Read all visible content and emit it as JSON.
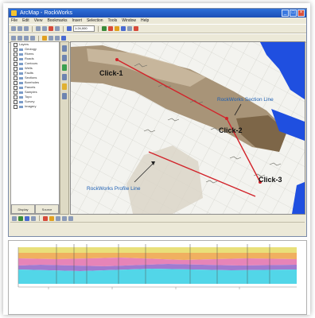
{
  "window": {
    "title": "ArcMap - RockWorks",
    "menu": [
      "File",
      "Edit",
      "View",
      "Bookmarks",
      "Insert",
      "Selection",
      "Tools",
      "Window",
      "Help"
    ],
    "scale_value": "1:24,000"
  },
  "toc": {
    "layers": [
      "Layers",
      "Geology",
      "Rivers",
      "Roads",
      "Contours",
      "Wells",
      "Faults",
      "Sections",
      "Boreholes",
      "Parcels",
      "Samples",
      "Topo",
      "Survey",
      "Imagery"
    ],
    "tabs": [
      "Display",
      "Source"
    ]
  },
  "map": {
    "annotations": {
      "click1": "Click-1",
      "click2": "Click-2",
      "click3": "Click-3",
      "section_line": "RockWorks Section Line",
      "profile_line": "RockWorks Profile Line"
    },
    "colors": {
      "water": "#1f4fe0",
      "terrain_brown": "#a89478",
      "terrain_dark": "#7d6648",
      "terrain_light": "#cdbca2",
      "section_line": "#d2232a"
    }
  },
  "profile": {
    "colors": {
      "top_band": "#e9e07a",
      "orange_band": "#f0b060",
      "pink_band": "#e684b8",
      "purple_band": "#a07ad0",
      "cyan_band": "#52d6e8"
    }
  }
}
